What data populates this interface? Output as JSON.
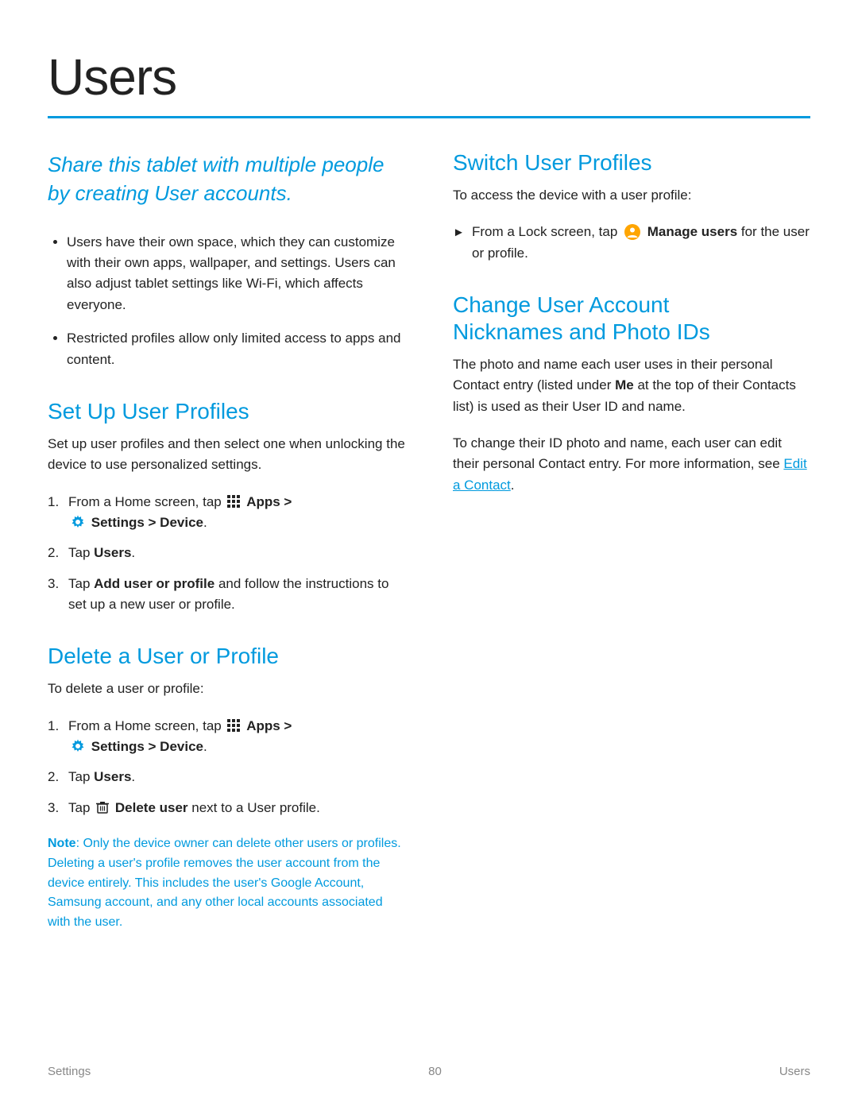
{
  "page": {
    "title": "Users",
    "rule_color": "#009ADE"
  },
  "footer": {
    "left": "Settings",
    "center": "80",
    "right": "Users"
  },
  "left_col": {
    "intro": "Share this tablet with multiple people by creating User accounts.",
    "bullets": [
      "Users have their own space, which they can customize with their own apps, wallpaper, and settings. Users can also adjust tablet settings like Wi-Fi, which affects everyone.",
      "Restricted profiles allow only limited access to apps and content."
    ],
    "set_up": {
      "heading": "Set Up User Profiles",
      "intro": "Set up user profiles and then select one when unlocking the device to use personalized settings.",
      "steps": [
        {
          "num": "1.",
          "text_before": "From a Home screen, tap",
          "apps_icon": true,
          "apps_label": "Apps >",
          "settings_icon": true,
          "text_after": "Settings > Device.",
          "bold_parts": [
            "Apps >",
            "Settings > Device."
          ]
        },
        {
          "num": "2.",
          "text": "Tap",
          "bold": "Users",
          "text_after": "."
        },
        {
          "num": "3.",
          "text": "Tap",
          "bold": "Add user or profile",
          "text_after": " and follow the instructions to set up a new user or profile."
        }
      ]
    },
    "delete": {
      "heading": "Delete a User or Profile",
      "intro": "To delete a user or profile:",
      "steps": [
        {
          "num": "1.",
          "text_before": "From a Home screen, tap",
          "apps_icon": true,
          "apps_label": "Apps >",
          "settings_icon": true,
          "text_after": "Settings > Device.",
          "bold_parts": [
            "Apps >",
            "Settings > Device."
          ]
        },
        {
          "num": "2.",
          "text": "Tap",
          "bold": "Users",
          "text_after": "."
        },
        {
          "num": "3.",
          "text": "Tap",
          "trash_icon": true,
          "bold": "Delete user",
          "text_after": " next to a User profile."
        }
      ],
      "note_label": "Note",
      "note_text": ": Only the device owner can delete other users or profiles. Deleting a user’s profile removes the user account from the device entirely. This includes the user’s Google Account, Samsung account, and any other local accounts associated with the user."
    }
  },
  "right_col": {
    "switch": {
      "heading": "Switch User Profiles",
      "intro": "To access the device with a user profile:",
      "bullet_text_before": "From a Lock screen, tap",
      "manage_icon": true,
      "bold": "Manage users",
      "text_after": " for the user or profile."
    },
    "change": {
      "heading1": "Change User Account",
      "heading2": "Nicknames and Photo IDs",
      "para1": "The photo and name each user uses in their personal Contact entry (listed under",
      "bold1": "Me",
      "para1b": " at the top of their Contacts list) is used as their User ID and name.",
      "para2": "To change their ID photo and name, each user can edit their personal Contact entry. For more information, see",
      "link_text": "Edit a Contact",
      "para2b": "."
    }
  }
}
